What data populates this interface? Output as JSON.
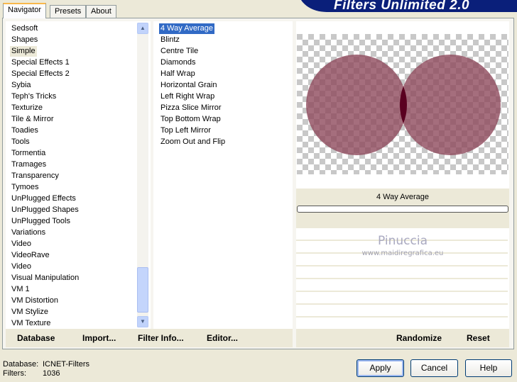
{
  "title": "Filters Unlimited 2.0",
  "tabs": [
    {
      "label": "Navigator"
    },
    {
      "label": "Presets"
    },
    {
      "label": "About"
    }
  ],
  "categories": [
    "Sedsoft",
    "Shapes",
    "Simple",
    "Special Effects 1",
    "Special Effects 2",
    "Sybia",
    "Teph's Tricks",
    "Texturize",
    "Tile & Mirror",
    "Toadies",
    "Tools",
    "Tormentia",
    "Tramages",
    "Transparency",
    "Tymoes",
    "UnPlugged Effects",
    "UnPlugged Shapes",
    "UnPlugged Tools",
    "Variations",
    "Video",
    "VideoRave",
    "Video",
    "Visual Manipulation",
    "VM 1",
    "VM Distortion",
    "VM Stylize",
    "VM Texture"
  ],
  "selected_category": "Simple",
  "filters": [
    "4 Way Average",
    "Blintz",
    "Centre Tile",
    "Diamonds",
    "Half Wrap",
    "Horizontal Grain",
    "Left Right Wrap",
    "Pizza Slice Mirror",
    "Top Bottom Wrap",
    "Top Left Mirror",
    "Zoom Out and Flip"
  ],
  "selected_filter": "4 Way Average",
  "preview": {
    "filter_name": "4 Way Average",
    "progress": 0,
    "circle_color": "#8e4a5c",
    "overlap_color": "#5a0020"
  },
  "watermark": {
    "name": "Pinuccia",
    "url": "www.maidiregrafica.eu"
  },
  "toolbar": {
    "database": "Database",
    "import": "Import...",
    "filter_info": "Filter Info...",
    "editor": "Editor...",
    "randomize": "Randomize",
    "reset": "Reset"
  },
  "status": {
    "database_label": "Database:",
    "database_value": "ICNET-Filters",
    "filters_label": "Filters:",
    "filters_value": "1036"
  },
  "buttons": {
    "apply": "Apply",
    "cancel": "Cancel",
    "help": "Help"
  }
}
